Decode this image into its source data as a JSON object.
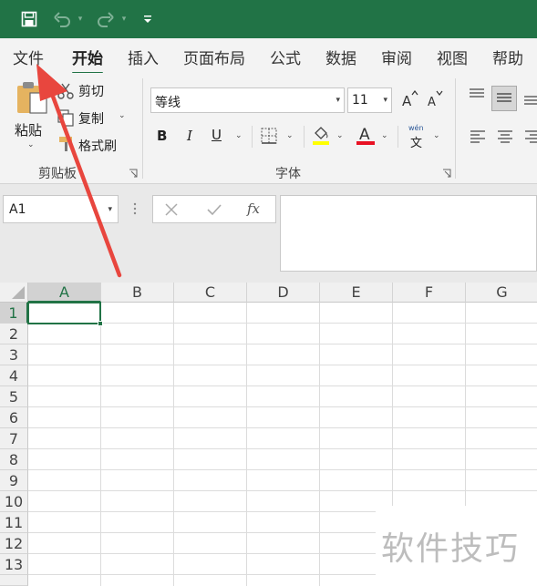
{
  "colors": {
    "accent": "#217346",
    "arrow": "#e8463e"
  },
  "quick_access": {
    "save_icon": "save-icon",
    "undo_icon": "undo-icon",
    "redo_icon": "redo-icon",
    "customize_icon": "customize-quick-access-icon"
  },
  "tabs": [
    {
      "label": "文件"
    },
    {
      "label": "开始"
    },
    {
      "label": "插入"
    },
    {
      "label": "页面布局"
    },
    {
      "label": "公式"
    },
    {
      "label": "数据"
    },
    {
      "label": "审阅"
    },
    {
      "label": "视图"
    },
    {
      "label": "帮助"
    }
  ],
  "ribbon": {
    "clipboard": {
      "paste": "粘贴",
      "cut": "剪切",
      "copy": "复制",
      "format_painter": "格式刷",
      "group_label": "剪贴板"
    },
    "font": {
      "font_name": "等线",
      "font_size": "11",
      "group_label": "字体",
      "phonetic": "wén",
      "phonetic_char": "文"
    }
  },
  "formula_bar": {
    "name_box": "A1",
    "fx": "fx",
    "value": ""
  },
  "grid": {
    "columns": [
      "A",
      "B",
      "C",
      "D",
      "E",
      "F",
      "G"
    ],
    "rows": [
      "1",
      "2",
      "3",
      "4",
      "5",
      "6",
      "7",
      "8",
      "9",
      "10",
      "11",
      "12",
      "13"
    ],
    "selected_cell": "A1"
  },
  "watermark": "软件技巧"
}
